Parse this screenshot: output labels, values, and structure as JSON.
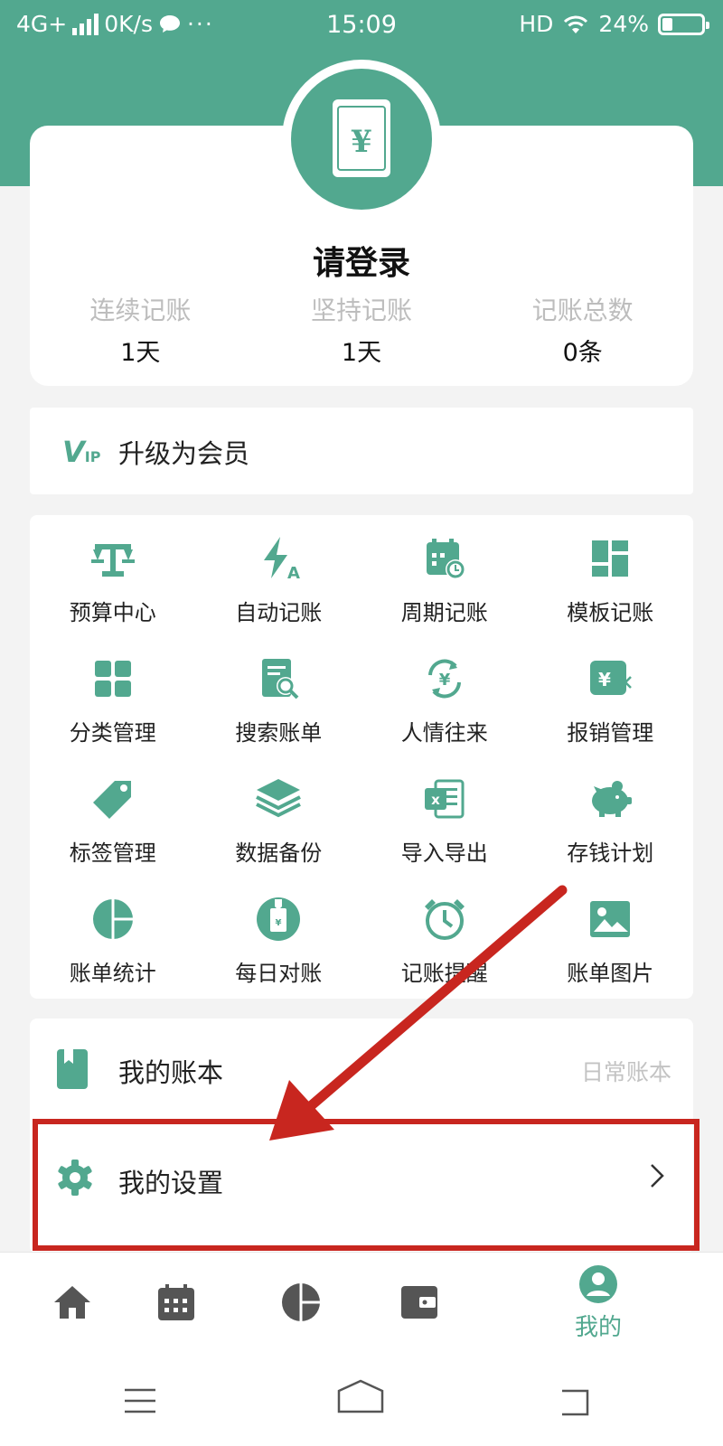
{
  "status_bar": {
    "network": "4G+",
    "speed": "0K/s",
    "time": "15:09",
    "hd": "HD",
    "battery": "24%"
  },
  "profile": {
    "login_text": "请登录",
    "stats": [
      {
        "label": "连续记账",
        "value": "1天"
      },
      {
        "label": "坚持记账",
        "value": "1天"
      },
      {
        "label": "记账总数",
        "value": "0条"
      }
    ]
  },
  "vip": {
    "badge": "V",
    "badge_sub": "IP",
    "label": "升级为会员"
  },
  "features": [
    {
      "label": "预算中心",
      "icon": "scale-icon"
    },
    {
      "label": "自动记账",
      "icon": "flash-auto-icon"
    },
    {
      "label": "周期记账",
      "icon": "calendar-cycle-icon"
    },
    {
      "label": "模板记账",
      "icon": "template-grid-icon"
    },
    {
      "label": "分类管理",
      "icon": "category-grid-icon"
    },
    {
      "label": "搜索账单",
      "icon": "search-bill-icon"
    },
    {
      "label": "人情往来",
      "icon": "money-exchange-icon"
    },
    {
      "label": "报销管理",
      "icon": "reimburse-icon"
    },
    {
      "label": "标签管理",
      "icon": "tag-icon"
    },
    {
      "label": "数据备份",
      "icon": "layers-icon"
    },
    {
      "label": "导入导出",
      "icon": "excel-icon"
    },
    {
      "label": "存钱计划",
      "icon": "piggy-bank-icon"
    },
    {
      "label": "账单统计",
      "icon": "pie-chart-icon"
    },
    {
      "label": "每日对账",
      "icon": "daily-check-icon"
    },
    {
      "label": "记账提醒",
      "icon": "alarm-clock-icon"
    },
    {
      "label": "账单图片",
      "icon": "image-icon"
    }
  ],
  "list": {
    "book": {
      "label": "我的账本",
      "value": "日常账本"
    },
    "settings": {
      "label": "我的设置"
    }
  },
  "tabs": {
    "mine_label": "我的"
  },
  "colors": {
    "accent": "#52a88f",
    "highlight": "#c8261f"
  }
}
